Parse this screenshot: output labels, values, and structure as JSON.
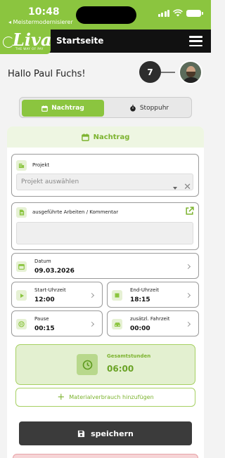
{
  "status_bar": {
    "time": "10:48",
    "carrier": "◂ Meistermodernisierer"
  },
  "header": {
    "logo_text": "Liva",
    "logo_tagline": "THE WAY OF PAY",
    "title": "Startseite",
    "menu_icon": "hamburger-menu-icon"
  },
  "greeting": "Hallo Paul Fuchs!",
  "notification_count": "7",
  "tabs": [
    {
      "label": "Nachtrag",
      "icon": "calendar-icon",
      "active": true
    },
    {
      "label": "Stoppuhr",
      "icon": "stopwatch-icon",
      "active": false
    }
  ],
  "form": {
    "section_title": "Nachtrag",
    "project": {
      "label": "Projekt",
      "placeholder": "Projekt auswählen"
    },
    "comment": {
      "label": "ausgeführte Arbeiten / Kommentar",
      "value": ""
    },
    "date": {
      "label": "Datum",
      "value": "09.03.2026"
    },
    "start_time": {
      "label": "Start-Uhrzeit",
      "value": "12:00"
    },
    "end_time": {
      "label": "End-Uhrzeit",
      "value": "18:15"
    },
    "pause": {
      "label": "Pause",
      "value": "00:15"
    },
    "drive_time": {
      "label": "zusätzl. Fahrzeit",
      "value": "00:00"
    },
    "total": {
      "label": "Gesamtstunden",
      "value": "06:00"
    },
    "material_button": "Materialverbrauch hinzufügen",
    "save_button": "speichern"
  },
  "colors": {
    "brand_green": "#8bc53f",
    "header_black": "#111111",
    "save_dark": "#3b3b3b"
  }
}
